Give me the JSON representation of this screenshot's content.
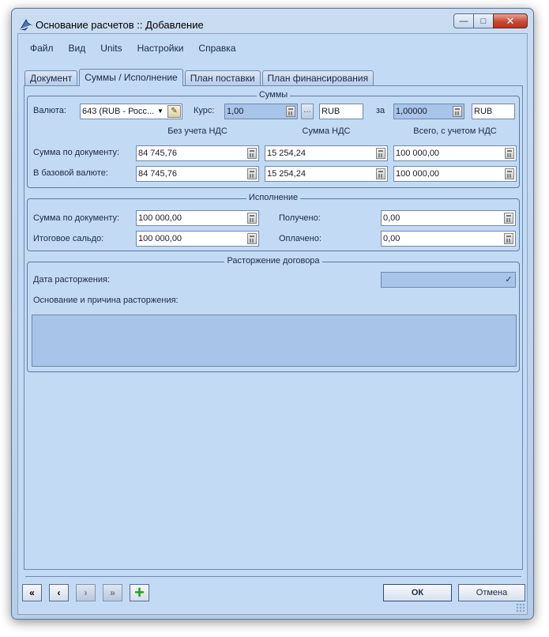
{
  "window": {
    "title": "Основание расчетов :: Добавление",
    "controls": {
      "minimize": "—",
      "maximize": "□",
      "close": "✕"
    }
  },
  "menu": [
    "Файл",
    "Вид",
    "Units",
    "Настройки",
    "Справка"
  ],
  "tabs": [
    {
      "label": "Документ",
      "active": false
    },
    {
      "label": "Суммы / Исполнение",
      "active": true
    },
    {
      "label": "План поставки",
      "active": false
    },
    {
      "label": "План финансирования",
      "active": false
    }
  ],
  "sums": {
    "title": "Суммы",
    "currency_label": "Валюта:",
    "currency_value": "643 (RUB - Росс...",
    "rate_label": "Курс:",
    "rate_value": "1,00",
    "rate_currency": "RUB",
    "per_label": "за",
    "per_value": "1,00000",
    "per_currency": "RUB",
    "col_headers": [
      "Без учета НДС",
      "Сумма НДС",
      "Всего, с учетом НДС"
    ],
    "rows": [
      {
        "label": "Сумма по документу:",
        "values": [
          "84 745,76",
          "15 254,24",
          "100 000,00"
        ]
      },
      {
        "label": "В базовой валюте:",
        "values": [
          "84 745,76",
          "15 254,24",
          "100 000,00"
        ]
      }
    ]
  },
  "execution": {
    "title": "Исполнение",
    "doc_sum_label": "Сумма по документу:",
    "doc_sum_value": "100 000,00",
    "balance_label": "Итоговое сальдо:",
    "balance_value": "100 000,00",
    "received_label": "Получено:",
    "received_value": "0,00",
    "paid_label": "Оплачено:",
    "paid_value": "0,00"
  },
  "termination": {
    "title": "Расторжение договора",
    "date_label": "Дата расторжения:",
    "date_value": "",
    "reason_label": "Основание и причина расторжения:",
    "reason_value": ""
  },
  "footer": {
    "first": "«",
    "prev": "‹",
    "next": "›",
    "last": "»",
    "add": "+",
    "ok": "ОК",
    "cancel": "Отмена"
  }
}
